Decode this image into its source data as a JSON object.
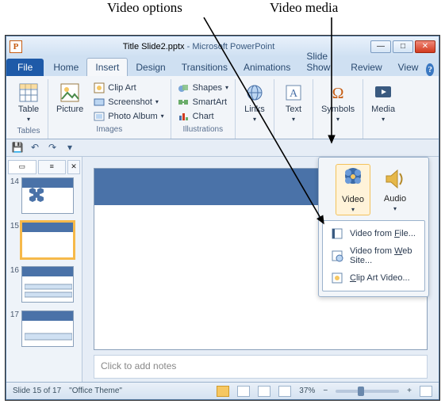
{
  "annotations": {
    "video_options": "Video options",
    "video_media": "Video media"
  },
  "window": {
    "doc_title": "Title Slide2.pptx",
    "app_title": "Microsoft PowerPoint",
    "sep": "  -  "
  },
  "ribbon": {
    "file": "File",
    "tabs": [
      "Home",
      "Insert",
      "Design",
      "Transitions",
      "Animations",
      "Slide Show",
      "Review",
      "View"
    ],
    "active_index": 1,
    "groups": {
      "tables": {
        "label": "Tables",
        "btn": "Table"
      },
      "images": {
        "label": "Images",
        "picture": "Picture",
        "clipart": "Clip Art",
        "screenshot": "Screenshot",
        "photo_album": "Photo Album"
      },
      "illustrations": {
        "label": "Illustrations",
        "shapes": "Shapes",
        "smartart": "SmartArt",
        "chart": "Chart"
      },
      "links": {
        "label": "Links",
        "btn": "Links"
      },
      "text": {
        "label": "Text",
        "btn": "Text"
      },
      "symbols": {
        "label": "Symbols",
        "btn": "Symbols"
      },
      "media": {
        "label": "Media",
        "btn": "Media"
      }
    }
  },
  "media_pop": {
    "video": "Video",
    "audio": "Audio",
    "items": {
      "from_file": "Video from ",
      "from_file_u": "F",
      "from_file_suffix": "ile...",
      "from_web": "Video from ",
      "from_web_u": "W",
      "from_web_suffix": "eb Site...",
      "clipart": "",
      "clipart_u": "C",
      "clipart_suffix": "lip Art Video..."
    }
  },
  "thumbs": {
    "numbers": [
      "14",
      "15",
      "16",
      "17"
    ],
    "selected_index": 1
  },
  "notes_placeholder": "Click to add notes",
  "status": {
    "slide": "Slide 15 of 17",
    "theme": "\"Office Theme\"",
    "lang": "",
    "zoom": "37%"
  }
}
